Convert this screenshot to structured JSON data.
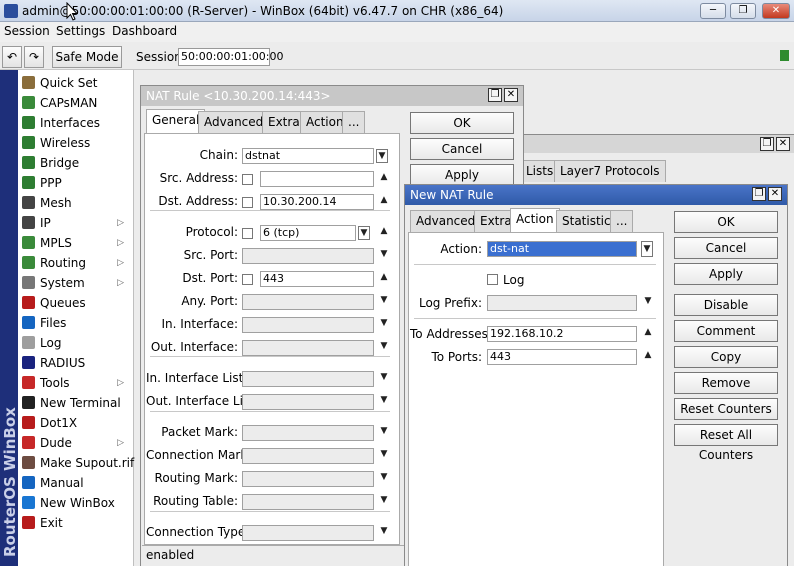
{
  "app": {
    "title": "admin@50:00:00:01:00:00 (R-Server) - WinBox (64bit) v6.47.7 on CHR (x86_64)",
    "brand": "RouterOS WinBox"
  },
  "menu": [
    "Session",
    "Settings",
    "Dashboard"
  ],
  "toolbar": {
    "safe_mode": "Safe Mode",
    "session_label": "Session:",
    "session_value": "50:00:00:01:00:00"
  },
  "sidebar": [
    {
      "label": "Quick Set",
      "icon": "wand-icon",
      "color": "#8a6d3b",
      "submenu": false
    },
    {
      "label": "CAPsMAN",
      "icon": "antenna-icon",
      "color": "#3a8a3a",
      "submenu": false
    },
    {
      "label": "Interfaces",
      "icon": "interfaces-icon",
      "color": "#2e7d32",
      "submenu": false
    },
    {
      "label": "Wireless",
      "icon": "wireless-icon",
      "color": "#2e7d32",
      "submenu": false
    },
    {
      "label": "Bridge",
      "icon": "bridge-icon",
      "color": "#2e7d32",
      "submenu": false
    },
    {
      "label": "PPP",
      "icon": "ppp-icon",
      "color": "#2e7d32",
      "submenu": false
    },
    {
      "label": "Mesh",
      "icon": "mesh-icon",
      "color": "#444444",
      "submenu": false
    },
    {
      "label": "IP",
      "icon": "ip-icon",
      "color": "#444444",
      "submenu": true
    },
    {
      "label": "MPLS",
      "icon": "mpls-icon",
      "color": "#3a8a3a",
      "submenu": true
    },
    {
      "label": "Routing",
      "icon": "routing-icon",
      "color": "#3a8a3a",
      "submenu": true
    },
    {
      "label": "System",
      "icon": "gear-icon",
      "color": "#777777",
      "submenu": true
    },
    {
      "label": "Queues",
      "icon": "queues-icon",
      "color": "#b71c1c",
      "submenu": false
    },
    {
      "label": "Files",
      "icon": "folder-icon",
      "color": "#1565c0",
      "submenu": false
    },
    {
      "label": "Log",
      "icon": "log-icon",
      "color": "#9e9e9e",
      "submenu": false
    },
    {
      "label": "RADIUS",
      "icon": "radius-icon",
      "color": "#1a237e",
      "submenu": false
    },
    {
      "label": "Tools",
      "icon": "tools-icon",
      "color": "#c62828",
      "submenu": true
    },
    {
      "label": "New Terminal",
      "icon": "terminal-icon",
      "color": "#212121",
      "submenu": false
    },
    {
      "label": "Dot1X",
      "icon": "dot1x-icon",
      "color": "#b71c1c",
      "submenu": false
    },
    {
      "label": "Dude",
      "icon": "dude-icon",
      "color": "#c62828",
      "submenu": true
    },
    {
      "label": "Make Supout.rif",
      "icon": "supout-icon",
      "color": "#6d4c41",
      "submenu": false
    },
    {
      "label": "Manual",
      "icon": "manual-icon",
      "color": "#1565c0",
      "submenu": false
    },
    {
      "label": "New WinBox",
      "icon": "winbox-icon",
      "color": "#1976d2",
      "submenu": false
    },
    {
      "label": "Exit",
      "icon": "exit-icon",
      "color": "#b71c1c",
      "submenu": false
    }
  ],
  "nat_rule": {
    "title": "NAT Rule <10.30.200.14:443>",
    "tabs": [
      "General",
      "Advanced",
      "Extra",
      "Action",
      "..."
    ],
    "fields": [
      {
        "label": "Chain:",
        "value": "dstnat",
        "check": false,
        "dis": false
      },
      {
        "label": "Src. Address:",
        "value": "",
        "check": true,
        "dis": false
      },
      {
        "label": "Dst. Address:",
        "value": "10.30.200.14",
        "check": true,
        "dis": false
      },
      {
        "label": "Protocol:",
        "value": "6 (tcp)",
        "check": true,
        "dis": false
      },
      {
        "label": "Src. Port:",
        "value": "",
        "check": false,
        "dis": true
      },
      {
        "label": "Dst. Port:",
        "value": "443",
        "check": true,
        "dis": false
      },
      {
        "label": "Any. Port:",
        "value": "",
        "check": false,
        "dis": true
      },
      {
        "label": "In. Interface:",
        "value": "",
        "check": false,
        "dis": true
      },
      {
        "label": "Out. Interface:",
        "value": "",
        "check": false,
        "dis": true
      },
      {
        "label": "In. Interface List:",
        "value": "",
        "check": false,
        "dis": true
      },
      {
        "label": "Out. Interface List:",
        "value": "",
        "check": false,
        "dis": true
      },
      {
        "label": "Packet Mark:",
        "value": "",
        "check": false,
        "dis": true
      },
      {
        "label": "Connection Mark:",
        "value": "",
        "check": false,
        "dis": true
      },
      {
        "label": "Routing Mark:",
        "value": "",
        "check": false,
        "dis": true
      },
      {
        "label": "Routing Table:",
        "value": "",
        "check": false,
        "dis": true
      },
      {
        "label": "Connection Type:",
        "value": "",
        "check": false,
        "dis": true
      }
    ],
    "buttons": [
      "OK",
      "Cancel",
      "Apply"
    ],
    "status": "enabled"
  },
  "bg_window": {
    "tabs": [
      "Lists",
      "Layer7 Protocols"
    ]
  },
  "new_nat": {
    "title": "New NAT Rule",
    "tabs": [
      "Advanced",
      "Extra",
      "Action",
      "Statistics",
      "..."
    ],
    "action_label": "Action:",
    "action_value": "dst-nat",
    "log_label": "Log",
    "log_prefix_label": "Log Prefix:",
    "to_addresses_label": "To Addresses:",
    "to_addresses": "192.168.10.2",
    "to_ports_label": "To Ports:",
    "to_ports": "443",
    "buttons": [
      "OK",
      "Cancel",
      "Apply",
      "Disable",
      "Comment",
      "Copy",
      "Remove",
      "Reset Counters",
      "Reset All Counters"
    ]
  }
}
